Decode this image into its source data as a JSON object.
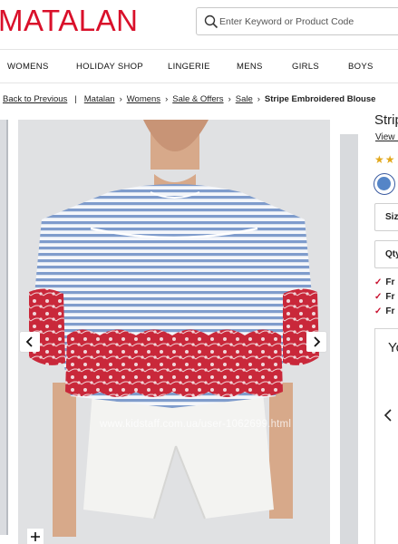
{
  "brand": {
    "logo_text": "MATALAN",
    "color": "#d9102a"
  },
  "search": {
    "placeholder": "Enter Keyword or Product Code",
    "icon": "search-icon"
  },
  "nav": {
    "items": [
      "WOMENS",
      "HOLIDAY SHOP",
      "LINGERIE",
      "MENS",
      "GIRLS",
      "BOYS"
    ]
  },
  "breadcrumb": {
    "back": "Back to Previous",
    "items": [
      "Matalan",
      "Womens",
      "Sale & Offers",
      "Sale"
    ],
    "current": "Stripe Embroidered Blouse"
  },
  "gallery": {
    "watermark": "www.kidstaff.com.ua/user-1062699.html",
    "prev_icon": "chevron-left-icon",
    "next_icon": "chevron-right-icon",
    "zoom_icon": "plus-icon"
  },
  "product_panel": {
    "title": "Strip",
    "view_link": "View P",
    "stars": "★★",
    "size_label": "Siz",
    "qty_label": "Qty",
    "benefits": [
      "Fr",
      "Fr",
      "Fr"
    ],
    "side_panel_title": "Yo",
    "accent_star": "#e2a81c",
    "accent_tick": "#c8102e",
    "swatch_color": "#5585c7"
  }
}
